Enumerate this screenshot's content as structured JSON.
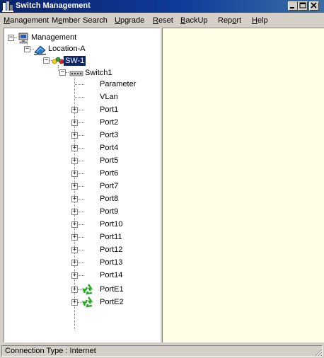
{
  "window": {
    "title": "Switch Management",
    "icon": "app-icon"
  },
  "menu": [
    {
      "label": "Management",
      "mnemonic": "M",
      "rest": "anagement"
    },
    {
      "label": "Member",
      "pre": "M",
      "mnemonic": "e",
      "rest": "mber"
    },
    {
      "label": "Search",
      "pre": "",
      "mnemonic": "S",
      "rest": "earch",
      "plain": true
    },
    {
      "label": "Upgrade",
      "pre": "",
      "mnemonic": "U",
      "rest": "pgrade"
    },
    {
      "label": "Reset",
      "pre": "",
      "mnemonic": "R",
      "rest": "eset"
    },
    {
      "label": "BackUp",
      "pre": "",
      "mnemonic": "B",
      "rest": "ackUp"
    },
    {
      "label": "Report",
      "pre": "Rep",
      "mnemonic": "o",
      "rest": "rt"
    },
    {
      "label": "Help",
      "pre": "",
      "mnemonic": "H",
      "rest": "elp"
    }
  ],
  "tree": {
    "root": "Management",
    "location": "Location-A",
    "device": "SW-1",
    "switch": "Switch1",
    "leaves": [
      "Parameter",
      "VLan"
    ],
    "ports": [
      "Port1",
      "Port2",
      "Port3",
      "Port4",
      "Port5",
      "Port6",
      "Port7",
      "Port8",
      "Port9",
      "Port10",
      "Port11",
      "Port12",
      "Port13",
      "Port14"
    ],
    "eports": [
      "PortE1",
      "PortE2"
    ],
    "expand_plus": "+",
    "expand_minus": "−"
  },
  "status": {
    "connection": "Connection Type : Internet"
  },
  "colors": {
    "title_bar": "#0a246a",
    "content_bg": "#ffffe7",
    "selection": "#0a246a"
  }
}
